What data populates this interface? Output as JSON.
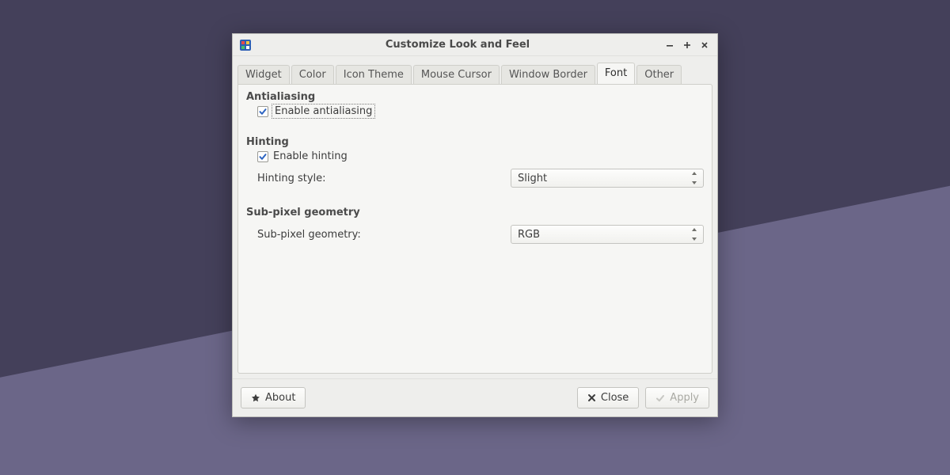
{
  "window": {
    "title": "Customize Look and Feel"
  },
  "tabs": {
    "widget": "Widget",
    "color": "Color",
    "icon_theme": "Icon Theme",
    "mouse_cursor": "Mouse Cursor",
    "window_border": "Window Border",
    "font": "Font",
    "other": "Other"
  },
  "sections": {
    "antialiasing": {
      "title": "Antialiasing",
      "enable_label": "Enable antialiasing",
      "enabled": true
    },
    "hinting": {
      "title": "Hinting",
      "enable_label": "Enable hinting",
      "enabled": true,
      "style_label": "Hinting style:",
      "style_value": "Slight"
    },
    "subpixel": {
      "title": "Sub-pixel geometry",
      "label": "Sub-pixel geometry:",
      "value": "RGB"
    }
  },
  "footer": {
    "about": "About",
    "close": "Close",
    "apply": "Apply"
  }
}
